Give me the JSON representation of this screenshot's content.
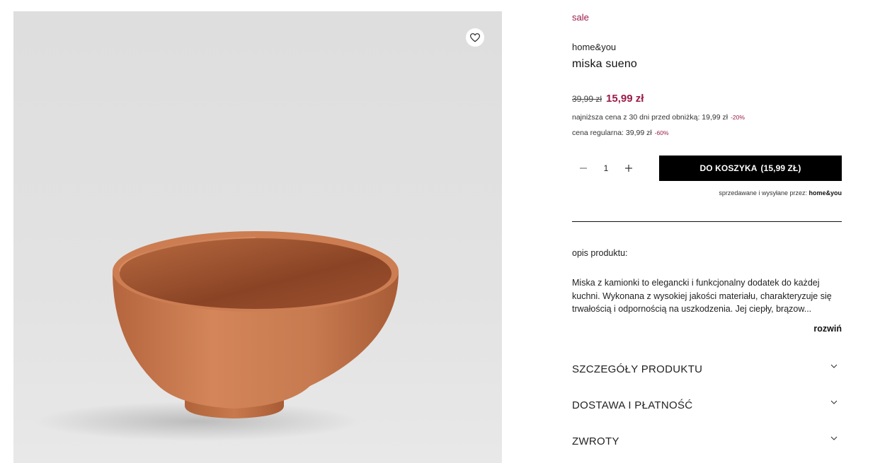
{
  "product": {
    "badge": "sale",
    "brand": "home&you",
    "name": "miska sueno",
    "old_price": "39,99 zł",
    "new_price": "15,99 zł",
    "lowest_price_text": "najniższa cena z 30 dni przed obniżką: 19,99 zł",
    "lowest_discount": "-20%",
    "regular_price_text": "cena regularna: 39,99 zł",
    "regular_discount": "-60%"
  },
  "cart": {
    "quantity": "1",
    "button_label": "DO KOSZYKA",
    "button_price": "(15,99 ZŁ)",
    "seller_prefix": "sprzedawane i wysyłane przez:",
    "seller_name": "home&you"
  },
  "description": {
    "heading": "opis produktu:",
    "text": "Miska z kamionki to elegancki i funkcjonalny dodatek do każdej kuchni. Wykonana z wysokiej jakości materiału, charakteryzuje się trwałością i odpornością na uszkodzenia. Jej ciepły, brązow...",
    "expand_label": "rozwiń"
  },
  "accordions": [
    {
      "title": "SZCZEGÓŁY PRODUKTU"
    },
    {
      "title": "DOSTAWA I PŁATNOŚĆ"
    },
    {
      "title": "ZWROTY"
    }
  ],
  "icons": {
    "wishlist": "heart-icon",
    "qty_minus": "minus-icon",
    "qty_plus": "plus-icon",
    "accordion": "chevron-down-icon"
  },
  "colors": {
    "accent": "#9b1b4a",
    "button_bg": "#000000",
    "image_bg": "#e0e0e0",
    "bowl": "#c77a4f"
  }
}
